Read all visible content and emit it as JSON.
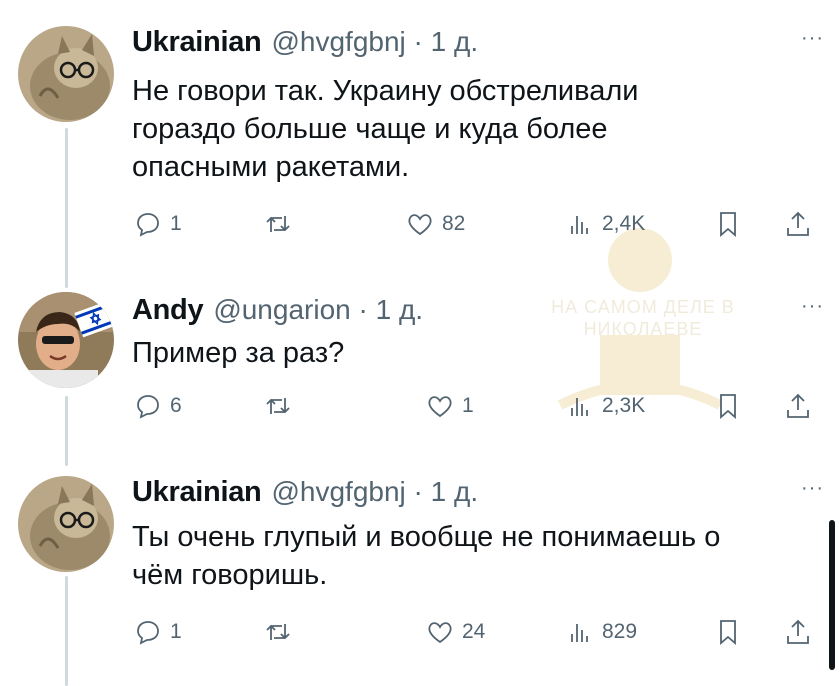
{
  "tweets": [
    {
      "name": "Ukrainian",
      "handle": "@hvgfgbnj · 1 д.",
      "more": "···",
      "avatar": "cat-with-glasses-avatar",
      "lines": [
        "Не говори так. Украину обстреливали",
        "гораздо больше чаще и куда более",
        "опасными ракетами."
      ],
      "reply": "1",
      "retweet": "",
      "like": "82",
      "views": "2,4K"
    },
    {
      "name": "Andy",
      "handle": "@ungarion · 1 д.",
      "more": "···",
      "avatar": "man-with-israel-flag-avatar",
      "lines": [
        "Пример за раз?"
      ],
      "reply": "6",
      "retweet": "",
      "like": "1",
      "views": "2,3K"
    },
    {
      "name": "Ukrainian",
      "handle": "@hvgfgbnj · 1 д.",
      "more": "···",
      "avatar": "cat-with-glasses-avatar",
      "lines": [
        "Ты очень глупый и вообще не понимаешь о",
        "чём говоришь."
      ],
      "reply": "1",
      "retweet": "",
      "like": "24",
      "views": "829"
    }
  ],
  "watermark": {
    "line1": "НА САМОМ ДЕЛЕ В",
    "line2": "НИКОЛАЕВЕ"
  },
  "icons": {
    "reply": "reply-icon",
    "retweet": "retweet-icon",
    "like": "heart-icon",
    "views": "views-icon",
    "bookmark": "bookmark-icon",
    "share": "share-icon"
  },
  "colors": {
    "text": "#0f1419",
    "secondary": "#536471",
    "thread_line": "#cfd9de"
  }
}
